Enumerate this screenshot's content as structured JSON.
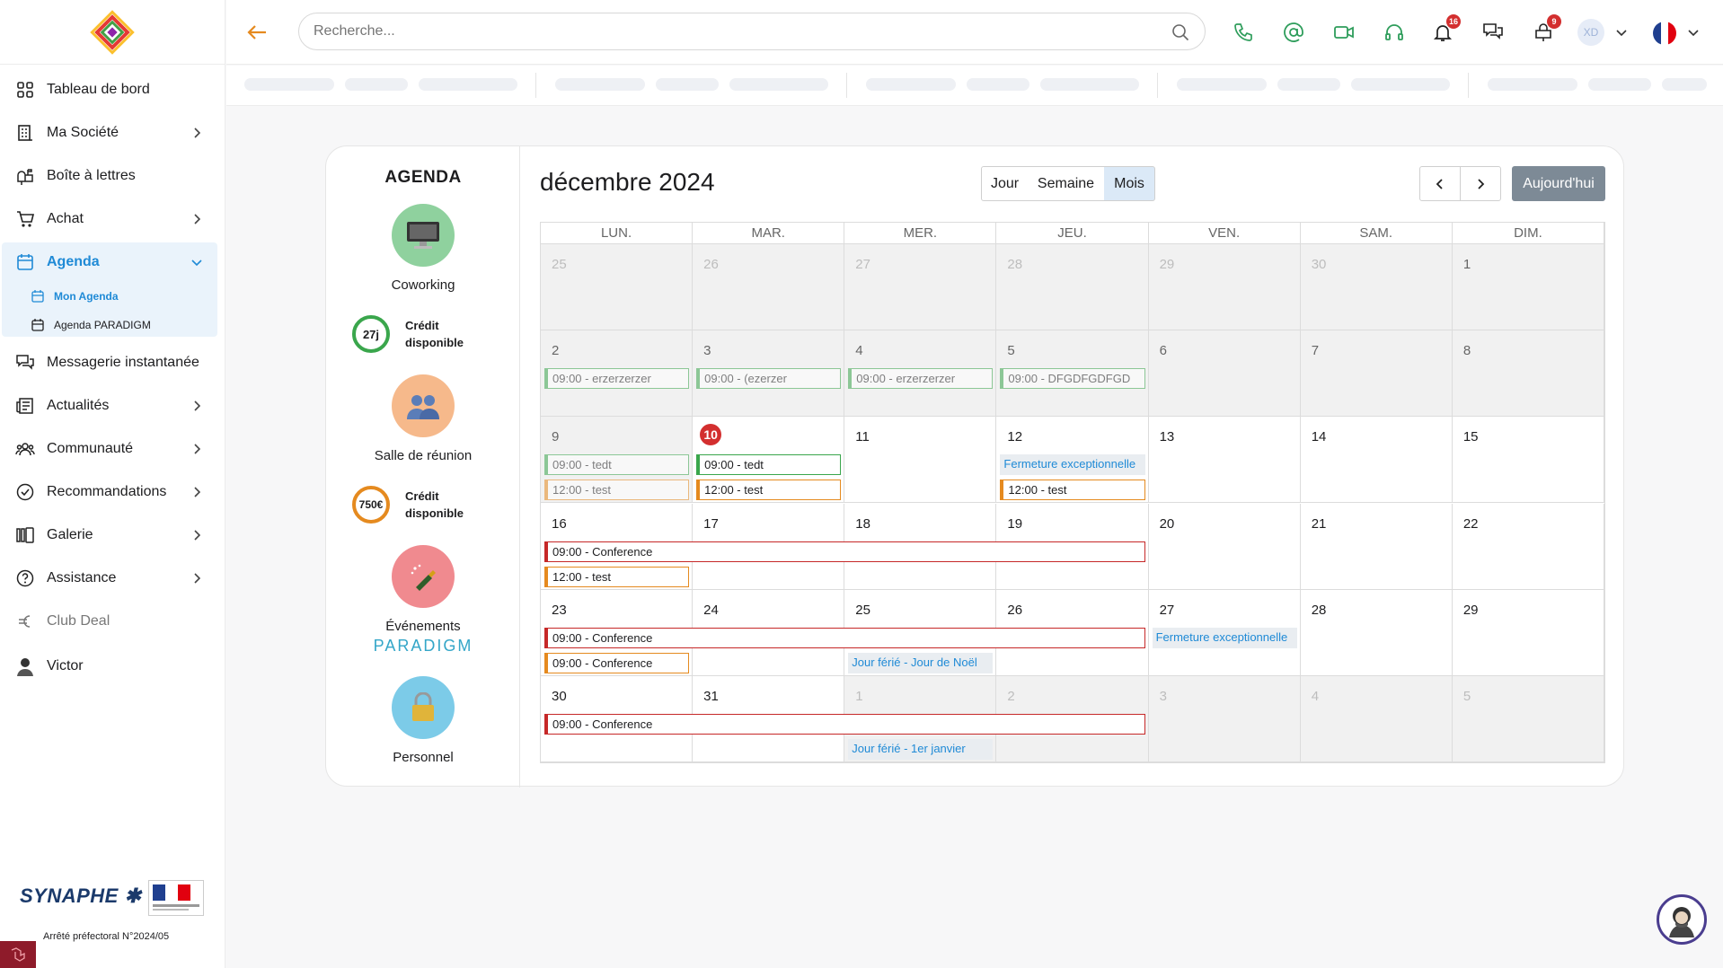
{
  "sidebar": {
    "items": [
      {
        "label": "Tableau de bord",
        "icon": "dashboard-icon"
      },
      {
        "label": "Ma Société",
        "icon": "building-icon"
      },
      {
        "label": "Boîte à lettres",
        "icon": "mailbox-icon"
      },
      {
        "label": "Achat",
        "icon": "cart-icon"
      },
      {
        "label": "Agenda",
        "icon": "calendar-icon"
      },
      {
        "label": "Messagerie instantanée",
        "icon": "chat-icon"
      },
      {
        "label": "Actualités",
        "icon": "news-icon"
      },
      {
        "label": "Communauté",
        "icon": "community-icon"
      },
      {
        "label": "Recommandations",
        "icon": "check-circle-icon"
      },
      {
        "label": "Galerie",
        "icon": "gallery-icon"
      },
      {
        "label": "Assistance",
        "icon": "help-icon"
      },
      {
        "label": "Club Deal",
        "icon": "euro-icon"
      },
      {
        "label": "Victor",
        "icon": "user-avatar-icon"
      }
    ],
    "agenda_sub": [
      {
        "label": "Mon Agenda"
      },
      {
        "label": "Agenda PARADIGM"
      }
    ],
    "footer": {
      "brand": "SYNAPHE",
      "arrete": "Arrêté préfectoral N°2024/05"
    }
  },
  "topbar": {
    "search_placeholder": "Recherche...",
    "notifications_count": "16",
    "alerts_count": "9",
    "user_initials": "XD"
  },
  "legend": {
    "title": "AGENDA",
    "categories": [
      {
        "label": "Coworking",
        "color": "#8fd19e"
      },
      {
        "label": "Salle de réunion",
        "color": "#f6b98b"
      },
      {
        "label": "Événements",
        "color": "#f08a8f"
      },
      {
        "label": "Personnel",
        "color": "#7ccbe8"
      }
    ],
    "credits": [
      {
        "value": "27j",
        "line1": "Crédit",
        "line2": "disponible",
        "color": "#3aa64c"
      },
      {
        "value": "750€",
        "line1": "Crédit",
        "line2": "disponible",
        "color": "#e58a1f"
      }
    ],
    "paradigm": "PARADIGM"
  },
  "calendar": {
    "month_title": "décembre 2024",
    "views": [
      "Jour",
      "Semaine",
      "Mois"
    ],
    "active_view": "Mois",
    "today_label": "Aujourd'hui",
    "weekdays": [
      "LUN.",
      "MAR.",
      "MER.",
      "JEU.",
      "VEN.",
      "SAM.",
      "DIM."
    ],
    "weeks": [
      [
        {
          "d": "25",
          "t": "other"
        },
        {
          "d": "26",
          "t": "other"
        },
        {
          "d": "27",
          "t": "other"
        },
        {
          "d": "28",
          "t": "other"
        },
        {
          "d": "29",
          "t": "other"
        },
        {
          "d": "30",
          "t": "other"
        },
        {
          "d": "1",
          "t": "past"
        }
      ],
      [
        {
          "d": "2",
          "t": "past"
        },
        {
          "d": "3",
          "t": "past"
        },
        {
          "d": "4",
          "t": "past"
        },
        {
          "d": "5",
          "t": "past"
        },
        {
          "d": "6",
          "t": "past"
        },
        {
          "d": "7",
          "t": "past"
        },
        {
          "d": "8",
          "t": "past"
        }
      ],
      [
        {
          "d": "9",
          "t": "past"
        },
        {
          "d": "10",
          "t": "today"
        },
        {
          "d": "11",
          "t": "cur"
        },
        {
          "d": "12",
          "t": "cur"
        },
        {
          "d": "13",
          "t": "cur"
        },
        {
          "d": "14",
          "t": "cur"
        },
        {
          "d": "15",
          "t": "cur"
        }
      ],
      [
        {
          "d": "16",
          "t": "cur"
        },
        {
          "d": "17",
          "t": "cur"
        },
        {
          "d": "18",
          "t": "cur"
        },
        {
          "d": "19",
          "t": "cur"
        },
        {
          "d": "20",
          "t": "cur"
        },
        {
          "d": "21",
          "t": "cur"
        },
        {
          "d": "22",
          "t": "cur"
        }
      ],
      [
        {
          "d": "23",
          "t": "cur"
        },
        {
          "d": "24",
          "t": "cur"
        },
        {
          "d": "25",
          "t": "cur"
        },
        {
          "d": "26",
          "t": "cur"
        },
        {
          "d": "27",
          "t": "cur"
        },
        {
          "d": "28",
          "t": "cur"
        },
        {
          "d": "29",
          "t": "cur"
        }
      ],
      [
        {
          "d": "30",
          "t": "cur"
        },
        {
          "d": "31",
          "t": "cur"
        },
        {
          "d": "1",
          "t": "other"
        },
        {
          "d": "2",
          "t": "other"
        },
        {
          "d": "3",
          "t": "other"
        },
        {
          "d": "4",
          "t": "other"
        },
        {
          "d": "5",
          "t": "other"
        }
      ]
    ],
    "events": [
      {
        "week": 1,
        "col": 0,
        "span": 1,
        "slot": 0,
        "text": "09:00 - erzerzerzer",
        "kind": "green",
        "faded": true
      },
      {
        "week": 1,
        "col": 1,
        "span": 1,
        "slot": 0,
        "text": "09:00 - (ezerzer",
        "kind": "green",
        "faded": true
      },
      {
        "week": 1,
        "col": 2,
        "span": 1,
        "slot": 0,
        "text": "09:00 - erzerzerzer",
        "kind": "green",
        "faded": true
      },
      {
        "week": 1,
        "col": 3,
        "span": 1,
        "slot": 0,
        "text": "09:00 - DFGDFGDFGD",
        "kind": "green",
        "faded": true
      },
      {
        "week": 2,
        "col": 0,
        "span": 1,
        "slot": 0,
        "text": "09:00 - tedt",
        "kind": "green",
        "faded": true
      },
      {
        "week": 2,
        "col": 0,
        "span": 1,
        "slot": 1,
        "text": "12:00 - test",
        "kind": "orange",
        "faded": true
      },
      {
        "week": 2,
        "col": 1,
        "span": 1,
        "slot": 0,
        "text": "09:00 - tedt",
        "kind": "green",
        "faded": false
      },
      {
        "week": 2,
        "col": 1,
        "span": 1,
        "slot": 1,
        "text": "12:00 - test",
        "kind": "orange",
        "faded": false
      },
      {
        "week": 2,
        "col": 3,
        "span": 1,
        "slot": 0,
        "text": "Fermeture exceptionnelle",
        "kind": "info",
        "faded": false
      },
      {
        "week": 2,
        "col": 3,
        "span": 1,
        "slot": 1,
        "text": "12:00 - test",
        "kind": "orange",
        "faded": false
      },
      {
        "week": 3,
        "col": 0,
        "span": 4,
        "slot": 0,
        "text": "09:00 - Conference",
        "kind": "red",
        "faded": false
      },
      {
        "week": 3,
        "col": 0,
        "span": 1,
        "slot": 1,
        "text": "12:00 - test",
        "kind": "orange",
        "faded": false
      },
      {
        "week": 4,
        "col": 0,
        "span": 4,
        "slot": 0,
        "text": "09:00 - Conference",
        "kind": "red",
        "faded": false
      },
      {
        "week": 4,
        "col": 4,
        "span": 1,
        "slot": 0,
        "text": "Fermeture exceptionnelle",
        "kind": "info",
        "faded": false
      },
      {
        "week": 4,
        "col": 0,
        "span": 1,
        "slot": 1,
        "text": "09:00 - Conference",
        "kind": "orange",
        "faded": false
      },
      {
        "week": 4,
        "col": 2,
        "span": 1,
        "slot": 1,
        "text": "Jour férié - Jour de Noël",
        "kind": "info",
        "faded": false
      },
      {
        "week": 5,
        "col": 0,
        "span": 4,
        "slot": 0,
        "text": "09:00 - Conference",
        "kind": "red",
        "faded": false
      },
      {
        "week": 5,
        "col": 2,
        "span": 1,
        "slot": 1,
        "text": "Jour férié - 1er janvier",
        "kind": "info",
        "faded": false
      }
    ]
  }
}
